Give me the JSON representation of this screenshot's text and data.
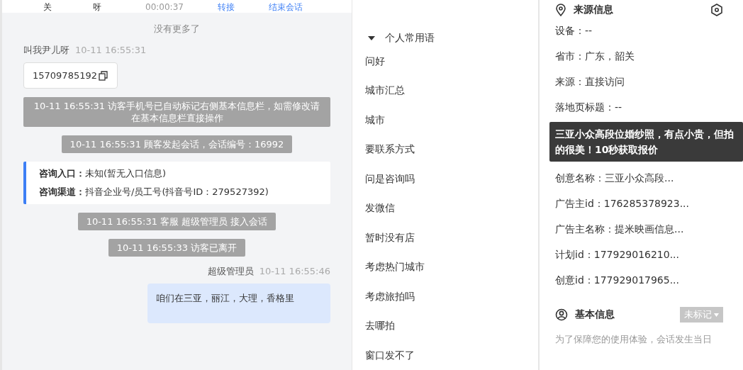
{
  "chat_header": {
    "cells": [
      "关",
      "呀",
      "00:00:37"
    ],
    "actions": [
      "转接",
      "结束会话"
    ]
  },
  "chat": {
    "no_more": "没有更多了",
    "messages": [
      {
        "kind": "visitor",
        "sender": "叫我尹儿呀",
        "time": "10-11 16:55:31",
        "text": "15709785192"
      },
      {
        "kind": "system",
        "text": "10-11 16:55:31 访客手机号已自动标记右侧基本信息栏，如需修改请在基本信息栏直接操作"
      },
      {
        "kind": "system",
        "text": "10-11 16:55:31 顾客发起会话，会话编号：16992"
      },
      {
        "kind": "info",
        "rows": [
          {
            "label": "咨询入口：",
            "value": "未知(暂无入口信息)"
          },
          {
            "label": "咨询渠道：",
            "value": "抖音企业号/员工号(抖音号ID：279527392)"
          }
        ]
      },
      {
        "kind": "system",
        "text": "10-11 16:55:31 客服 超级管理员 接入会话"
      },
      {
        "kind": "system",
        "text": "10-11 16:55:33 访客已离开"
      },
      {
        "kind": "agent",
        "sender": "超级管理员",
        "time": "10-11 16:55:46",
        "text": "咱们在三亚，丽江，大理，香格里"
      }
    ]
  },
  "phrases": {
    "group": {
      "label": "个人常用语",
      "expanded": true
    },
    "items": [
      "问好",
      "城市汇总",
      "城市",
      "要联系方式",
      "问是咨询吗",
      "发微信",
      "暂时没有店",
      "考虑热门城市",
      "考虑旅拍吗",
      "去哪拍",
      "窗口发不了"
    ]
  },
  "source_info": {
    "title": "来源信息",
    "rows_before": [
      "设备：--",
      "省市：广东，韶关",
      "来源：直接访问",
      "落地页标题：--"
    ],
    "tooltip": "三亚小众高段位婚纱照，有点小贵，但拍的很美！10秒获取报价",
    "rows_after": [
      "创意名称：三亚小众高段...",
      "广告主id：176285378923...",
      "广告主名称：提米映画信息...",
      "计划id：177929016210...",
      "创意id：177929017965..."
    ]
  },
  "basic_info": {
    "title": "基本信息",
    "tag": "未标记",
    "note": "为了保障您的使用体验，会话发生当日"
  }
}
